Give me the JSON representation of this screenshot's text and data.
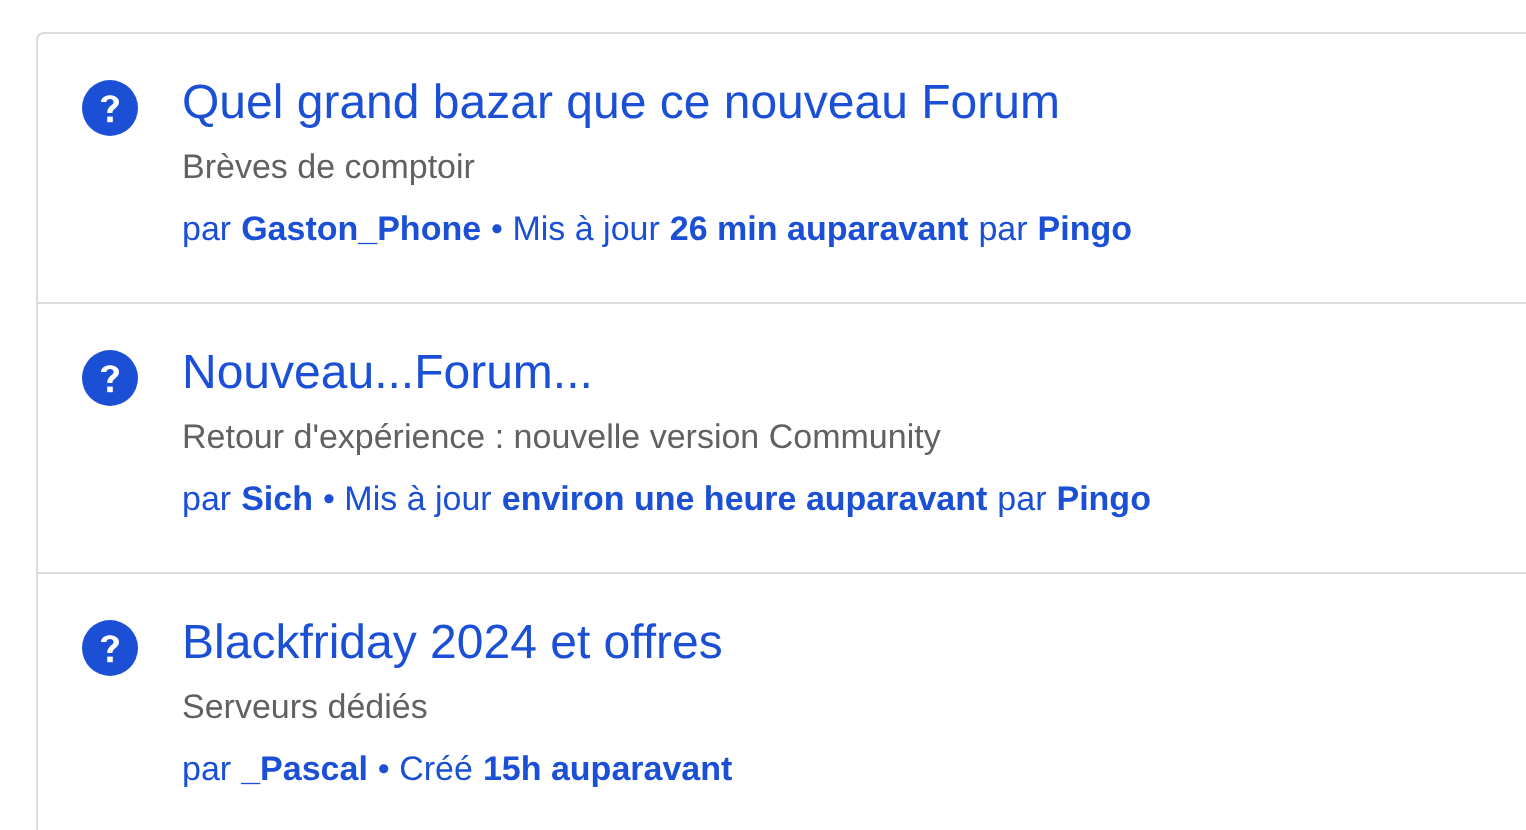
{
  "topics": [
    {
      "title": "Quel grand bazar que ce nouveau Forum",
      "category": "Brèves de comptoir",
      "meta": [
        {
          "kind": "text",
          "text": "par"
        },
        {
          "kind": "link",
          "text": "Gaston_Phone"
        },
        {
          "kind": "text",
          "text": "• Mis à jour"
        },
        {
          "kind": "link",
          "text": "26 min auparavant"
        },
        {
          "kind": "text",
          "text": "par"
        },
        {
          "kind": "link",
          "text": "Pingo"
        }
      ]
    },
    {
      "title": "Nouveau...Forum...",
      "category": "Retour d'expérience : nouvelle version Community",
      "meta": [
        {
          "kind": "text",
          "text": "par"
        },
        {
          "kind": "link",
          "text": "Sich"
        },
        {
          "kind": "text",
          "text": "• Mis à jour"
        },
        {
          "kind": "link",
          "text": "environ une heure auparavant"
        },
        {
          "kind": "text",
          "text": "par"
        },
        {
          "kind": "link",
          "text": "Pingo"
        }
      ]
    },
    {
      "title": "Blackfriday 2024 et offres",
      "category": "Serveurs dédiés",
      "meta": [
        {
          "kind": "text",
          "text": "par"
        },
        {
          "kind": "link",
          "text": "_Pascal"
        },
        {
          "kind": "text",
          "text": "• Créé"
        },
        {
          "kind": "link",
          "text": "15h auparavant"
        }
      ]
    }
  ]
}
